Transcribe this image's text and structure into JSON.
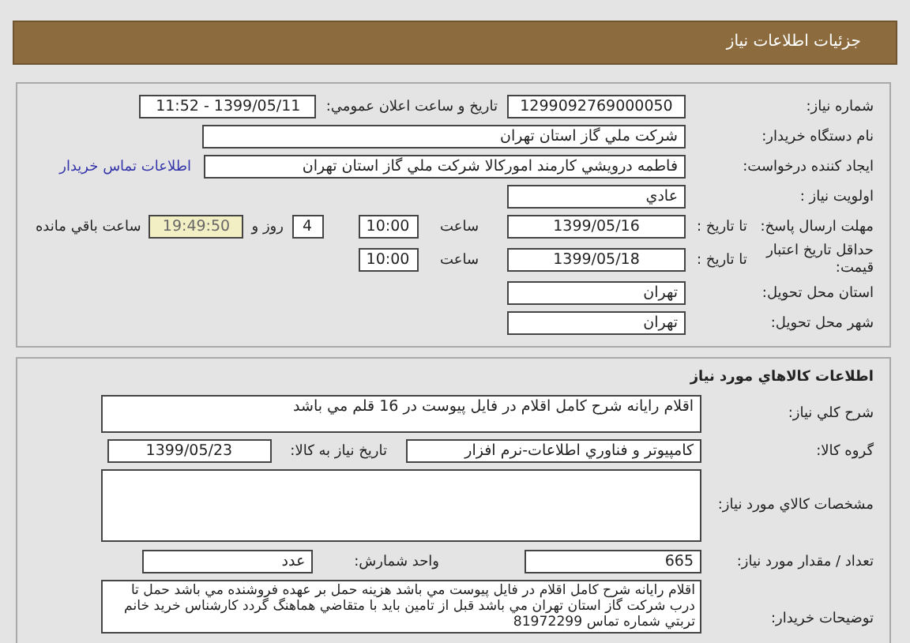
{
  "header": {
    "title": "جزئيات اطلاعات نياز"
  },
  "need_info": {
    "need_number": {
      "label": "شماره نياز:",
      "value": "1299092769000050"
    },
    "announce": {
      "label": "تاريخ و ساعت اعلان عمومي:",
      "value": "1399/05/11 - 11:52"
    },
    "buyer_org": {
      "label": "نام دستگاه خريدار:",
      "value": "شركت ملي گاز استان تهران"
    },
    "requester": {
      "label": "ايجاد كننده درخواست:",
      "value": "فاطمه درويشي كارمند اموركالا شركت ملي گاز استان تهران",
      "contact_link": "اطلاعات تماس خريدار"
    },
    "priority": {
      "label": "اولويت نياز :",
      "value": "عادي"
    },
    "reply_deadline": {
      "label": "مهلت ارسال پاسخ:",
      "sublabel": "تا تاريخ :",
      "date": "1399/05/16",
      "time_label": "ساعت",
      "time": "10:00",
      "days": "4",
      "days_label": "روز و",
      "remaining": "19:49:50",
      "remaining_label": "ساعت باقي مانده"
    },
    "price_validity": {
      "label": "حداقل تاريخ اعتبار قيمت:",
      "sublabel": "تا تاريخ :",
      "date": "1399/05/18",
      "time_label": "ساعت",
      "time": "10:00"
    },
    "province": {
      "label": "استان محل تحويل:",
      "value": "تهران"
    },
    "city": {
      "label": "شهر محل تحويل:",
      "value": "تهران"
    }
  },
  "goods": {
    "title": "اطلاعات كالاهاي مورد نياز",
    "summary": {
      "label": "شرح كلي نياز:",
      "value": "اقلام رايانه شرح كامل اقلام در فايل پيوست در 16 قلم مي باشد"
    },
    "group": {
      "label": "گروه كالا:",
      "value": "كامپيوتر و فناوري اطلاعات-نرم افزار",
      "need_date_label": "تاريخ نياز به كالا:",
      "need_date": "1399/05/23"
    },
    "specs": {
      "label": "مشخصات كالاي مورد نياز:"
    },
    "quantity": {
      "label": "تعداد / مقدار مورد نياز:",
      "value": "665",
      "unit_label": "واحد شمارش:",
      "unit": "عدد"
    },
    "buyer_notes": {
      "label": "توضيحات خريدار:",
      "value": "اقلام رايانه شرح كامل اقلام در فايل پيوست مي باشد هزينه حمل بر عهده فروشنده مي باشد حمل تا درب شركت گاز استان تهران مي باشد قبل از تامين بايد با متقاضي هماهنگ گردد كارشناس خريد خانم تربتي شماره تماس 81972299"
    }
  }
}
